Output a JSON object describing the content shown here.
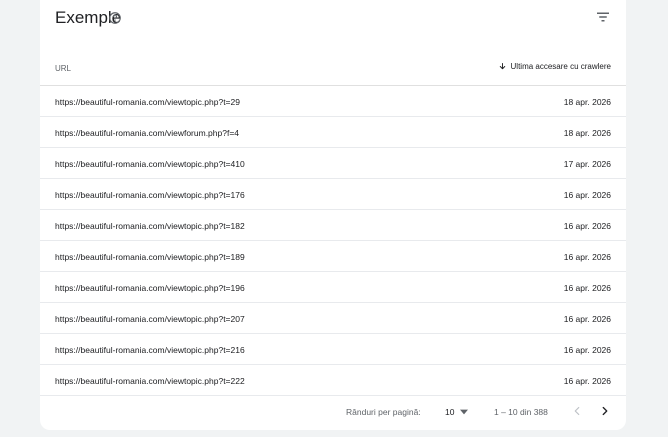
{
  "card": {
    "title": "Exemple",
    "help_icon": "help-circle-icon",
    "filter_icon": "filter-icon"
  },
  "table": {
    "columns": {
      "url": "URL",
      "last_crawl": "Ultima accesare cu crawlere"
    },
    "sort_icon": "arrow-down-icon",
    "rows": [
      {
        "url": "https://beautiful-romania.com/viewtopic.php?t=29",
        "date": "18 apr. 2026"
      },
      {
        "url": "https://beautiful-romania.com/viewforum.php?f=4",
        "date": "18 apr. 2026"
      },
      {
        "url": "https://beautiful-romania.com/viewtopic.php?t=410",
        "date": "17 apr. 2026"
      },
      {
        "url": "https://beautiful-romania.com/viewtopic.php?t=176",
        "date": "16 apr. 2026"
      },
      {
        "url": "https://beautiful-romania.com/viewtopic.php?t=182",
        "date": "16 apr. 2026"
      },
      {
        "url": "https://beautiful-romania.com/viewtopic.php?t=189",
        "date": "16 apr. 2026"
      },
      {
        "url": "https://beautiful-romania.com/viewtopic.php?t=196",
        "date": "16 apr. 2026"
      },
      {
        "url": "https://beautiful-romania.com/viewtopic.php?t=207",
        "date": "16 apr. 2026"
      },
      {
        "url": "https://beautiful-romania.com/viewtopic.php?t=216",
        "date": "16 apr. 2026"
      },
      {
        "url": "https://beautiful-romania.com/viewtopic.php?t=222",
        "date": "16 apr. 2026"
      }
    ]
  },
  "pagination": {
    "rows_per_page_label": "Rânduri per pagină:",
    "rows_per_page_value": "10",
    "range_text": "1 – 10 din 388",
    "prev_icon": "chevron-left-icon",
    "next_icon": "chevron-right-icon"
  },
  "colors": {
    "background": "#f1f3f4",
    "card": "#ffffff",
    "text": "#202124",
    "muted": "#5f6368",
    "divider": "#e8eaed"
  }
}
